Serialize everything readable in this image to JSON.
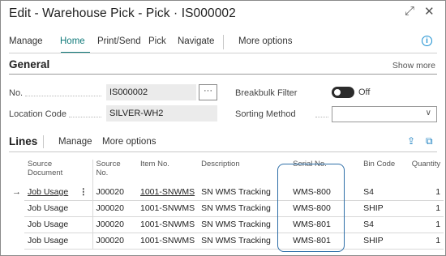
{
  "window": {
    "title": "Edit - Warehouse Pick - Pick · IS000002",
    "expand_icon": "expand-icon",
    "close_icon": "close-icon"
  },
  "actions": {
    "items": [
      "Manage",
      "Home",
      "Print/Send",
      "Pick",
      "Navigate"
    ],
    "more": "More options",
    "info_icon": "info-icon"
  },
  "general": {
    "title": "General",
    "show_more": "Show more",
    "no_label": "No.",
    "no_value": "IS000002",
    "ellipsis": "···",
    "location_label": "Location Code",
    "location_value": "SILVER-WH2",
    "breakbulk_label": "Breakbulk Filter",
    "breakbulk_value": "Off",
    "sorting_label": "Sorting Method",
    "sorting_value": ""
  },
  "lines": {
    "title": "Lines",
    "manage": "Manage",
    "more": "More options",
    "share_icon": "share-icon",
    "expand_icon": "open-in-new-icon",
    "columns": [
      "Source Document",
      "Source No.",
      "Item No.",
      "Description",
      "Serial No.",
      "Bin Code",
      "Quantity"
    ],
    "rows": [
      {
        "source_document": "Job Usage",
        "source_no": "J00020",
        "item_no": "1001-SNWMS",
        "description": "SN WMS Tracking",
        "serial_no": "WMS-800",
        "bin_code": "S4",
        "quantity": "1"
      },
      {
        "source_document": "Job Usage",
        "source_no": "J00020",
        "item_no": "1001-SNWMS",
        "description": "SN WMS Tracking",
        "serial_no": "WMS-800",
        "bin_code": "SHIP",
        "quantity": "1"
      },
      {
        "source_document": "Job Usage",
        "source_no": "J00020",
        "item_no": "1001-SNWMS",
        "description": "SN WMS Tracking",
        "serial_no": "WMS-801",
        "bin_code": "S4",
        "quantity": "1"
      },
      {
        "source_document": "Job Usage",
        "source_no": "J00020",
        "item_no": "1001-SNWMS",
        "description": "SN WMS Tracking",
        "serial_no": "WMS-801",
        "bin_code": "SHIP",
        "quantity": "1"
      }
    ]
  }
}
